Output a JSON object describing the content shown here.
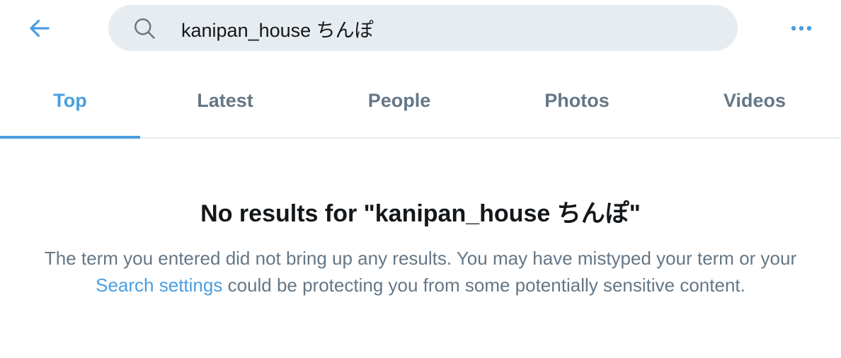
{
  "header": {
    "back_icon": "arrow-left-icon",
    "search_icon": "search-icon",
    "search_value": "kanipan_house ちんぽ",
    "more_icon": "more-horizontal-icon"
  },
  "tabs": [
    {
      "label": "Top",
      "active": true
    },
    {
      "label": "Latest",
      "active": false
    },
    {
      "label": "People",
      "active": false
    },
    {
      "label": "Photos",
      "active": false
    },
    {
      "label": "Videos",
      "active": false
    }
  ],
  "empty_state": {
    "title": "No results for \"kanipan_house ちんぽ\"",
    "body_before_link": "The term you entered did not bring up any results. You may have mistyped your term or your ",
    "link_text": "Search settings",
    "body_after_link": " could be protecting you from some potentially sensitive content."
  },
  "colors": {
    "accent": "#4a9ee0",
    "muted_text": "#657786",
    "primary_text": "#14171a",
    "search_bg": "#e6ecf0",
    "divider": "#e6ecf0"
  }
}
